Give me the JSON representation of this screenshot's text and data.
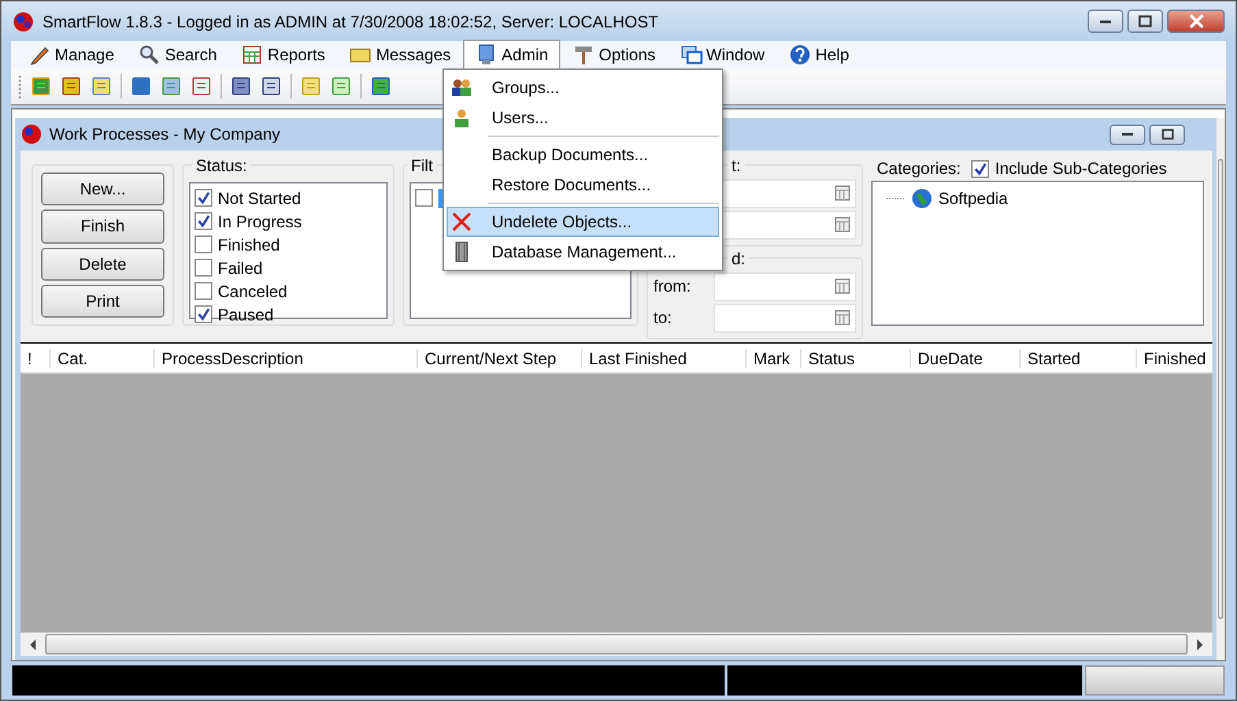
{
  "window": {
    "title": "SmartFlow 1.8.3 - Logged in as ADMIN at 7/30/2008 18:02:52, Server: LOCALHOST"
  },
  "menu": [
    {
      "label": "Manage",
      "selected": false
    },
    {
      "label": "Search",
      "selected": false
    },
    {
      "label": "Reports",
      "selected": false
    },
    {
      "label": "Messages",
      "selected": false
    },
    {
      "label": "Admin",
      "selected": true
    },
    {
      "label": "Options",
      "selected": false
    },
    {
      "label": "Window",
      "selected": false
    },
    {
      "label": "Help",
      "selected": false
    }
  ],
  "admin_menu": [
    {
      "kind": "item",
      "label": "Groups...",
      "selected": false
    },
    {
      "kind": "item",
      "label": "Users...",
      "selected": false
    },
    {
      "kind": "separator"
    },
    {
      "kind": "item",
      "label": "Backup Documents...",
      "selected": false
    },
    {
      "kind": "item",
      "label": "Restore Documents...",
      "selected": false
    },
    {
      "kind": "separator"
    },
    {
      "kind": "item",
      "label": "Undelete Objects...",
      "selected": true
    },
    {
      "kind": "item",
      "label": "Database Management...",
      "selected": false
    }
  ],
  "child": {
    "title": "Work Processes - My Company"
  },
  "buttons": [
    "New...",
    "Finish",
    "Delete",
    "Print"
  ],
  "status": {
    "label": "Status:",
    "items": [
      {
        "label": "Not Started",
        "checked": true
      },
      {
        "label": "In Progress",
        "checked": true
      },
      {
        "label": "Finished",
        "checked": false
      },
      {
        "label": "Failed",
        "checked": false
      },
      {
        "label": "Canceled",
        "checked": false
      },
      {
        "label": "Paused",
        "checked": true
      }
    ]
  },
  "filter": {
    "label": "Filt",
    "items": [
      {
        "checked": false,
        "selected": true
      }
    ]
  },
  "date_group_1": {
    "label": "t:"
  },
  "date_group_2": {
    "label": "d:",
    "fields": [
      "from:",
      "to:"
    ]
  },
  "categories": {
    "label": "Categories:",
    "include_sub": {
      "label": "Include Sub-Categories",
      "checked": true
    },
    "tree": [
      {
        "label": "Softpedia"
      }
    ]
  },
  "table": {
    "columns": [
      "!",
      "Cat.",
      "ProcessDescription",
      "Current/Next Step",
      "Last Finished",
      "Mark",
      "Status",
      "DueDate",
      "Started",
      "Finished"
    ]
  }
}
